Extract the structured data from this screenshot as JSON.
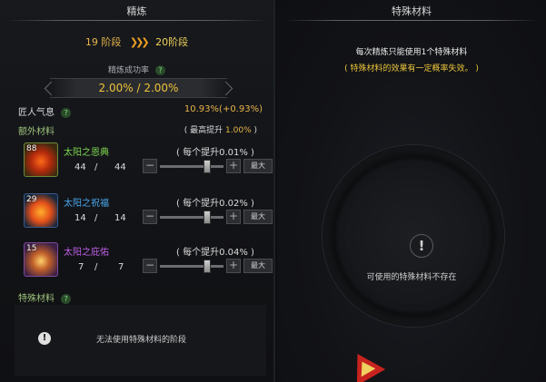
{
  "left": {
    "title": "精炼",
    "stage_from": "19 阶段",
    "stage_arrows": "❯❯❯",
    "stage_to": "20阶段",
    "success_rate_label": "精炼成功率",
    "success_rate_value": "2.00% / 2.00%",
    "artisan_label": "匠人气息",
    "artisan_value": "10.93%(+0.93%)",
    "extra_title": "额外材料",
    "max_inc_prefix": "( 最高提升 ",
    "max_inc_value": "1.00%",
    "max_inc_suffix": " )",
    "materials": [
      {
        "count": "88",
        "name": "太阳之恩典",
        "name_color": "#7fd64f",
        "have": "44",
        "sep": "/",
        "use": "44",
        "per": "( 每个提升0.01% )",
        "level": 1.0,
        "max_label": "最大"
      },
      {
        "count": "29",
        "name": "太阳之祝福",
        "name_color": "#4aa8f0",
        "have": "14",
        "sep": "/",
        "use": "14",
        "per": "( 每个提升0.02% )",
        "level": 1.0,
        "max_label": "最大"
      },
      {
        "count": "15",
        "name": "太阳之庇佑",
        "name_color": "#c060e8",
        "have": "7",
        "sep": "/",
        "use": "7",
        "per": "( 每个提升0.04% )",
        "level": 1.0,
        "max_label": "最大"
      }
    ],
    "special_title": "特殊材料",
    "special_msg": "无法使用特殊材料的阶段"
  },
  "right": {
    "title": "特殊材料",
    "notice1": "每次精炼只能使用1个特殊材料",
    "notice2": "( 特殊材料的效果有一定概率失效。 )",
    "empty_msg": "可使用的特殊材料不存在"
  },
  "icons": {
    "help": "question-icon",
    "warning": "exclamation-icon",
    "minus": "minus-icon",
    "plus": "plus-icon"
  }
}
